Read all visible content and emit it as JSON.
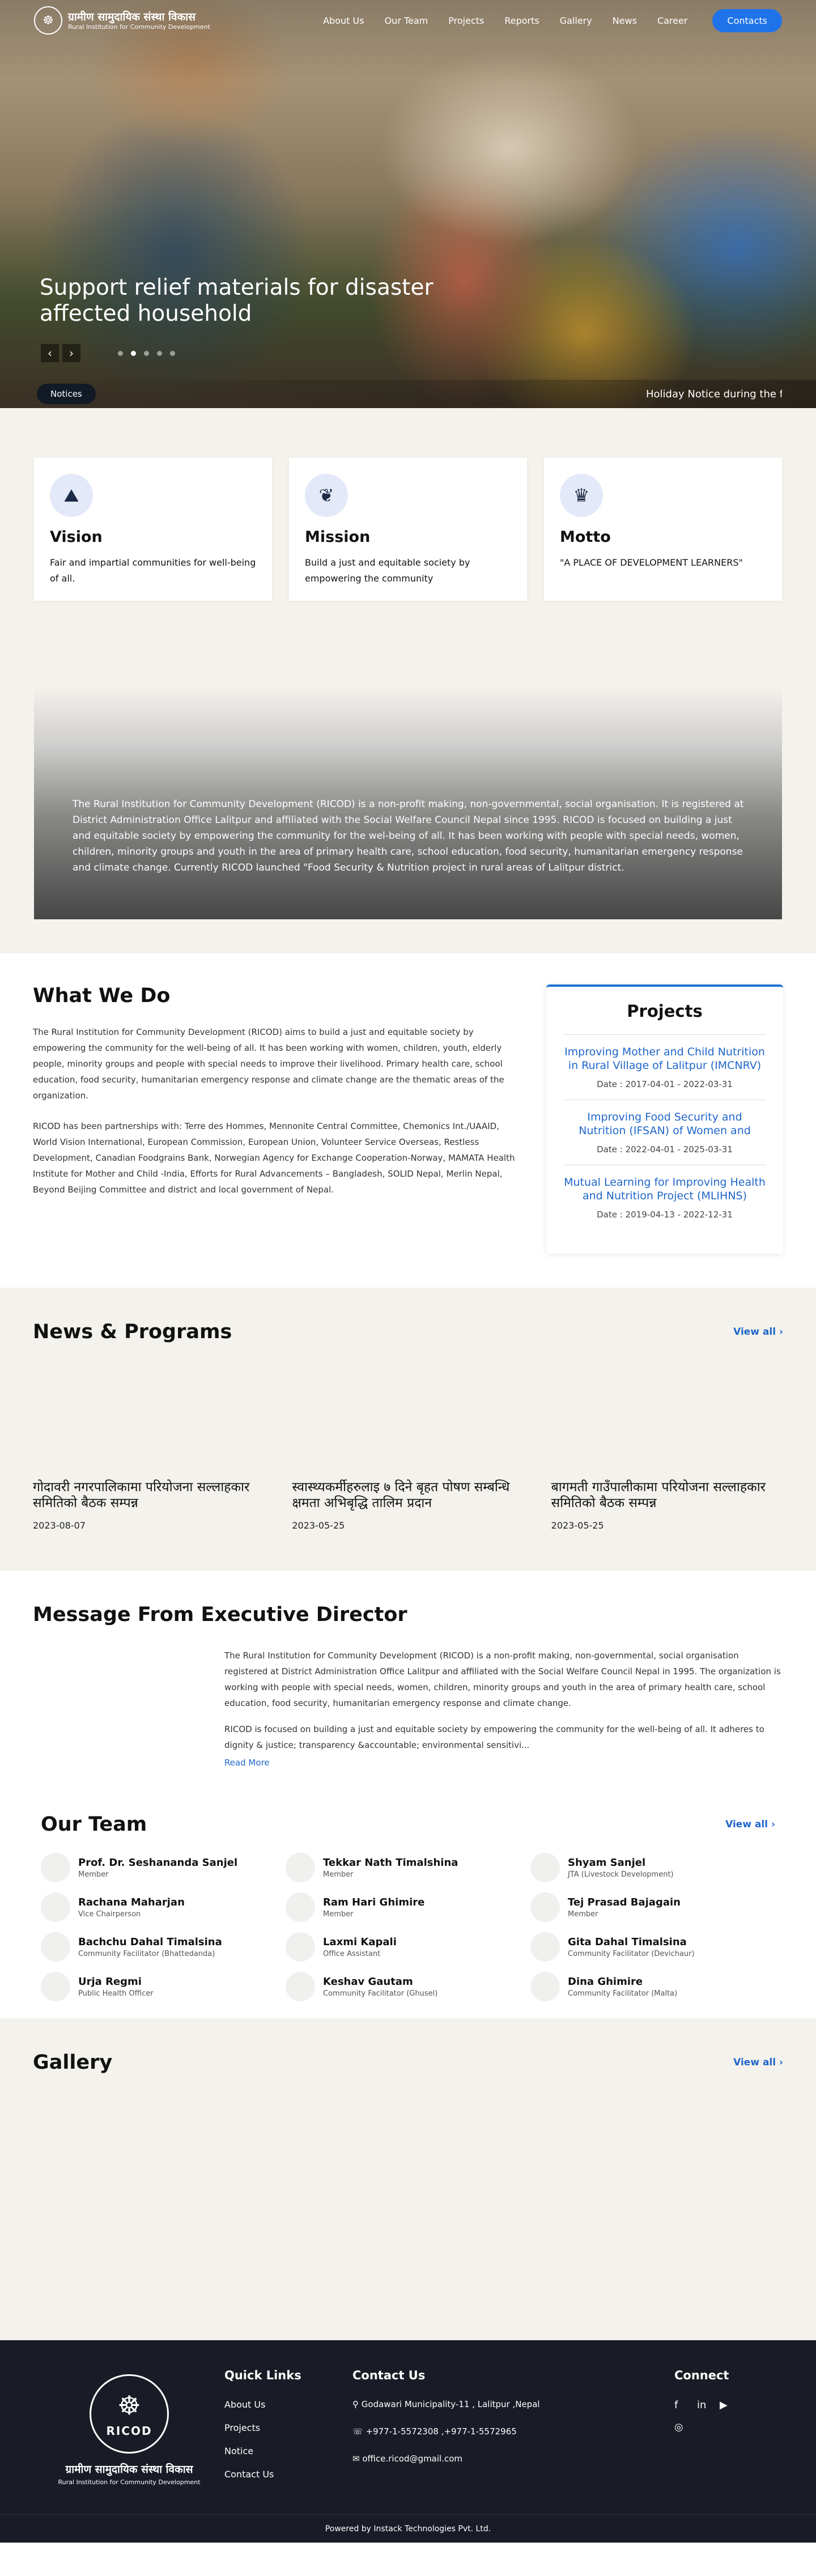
{
  "nav": {
    "brand_name": "ग्रामीण सामुदायिक संस्था विकास",
    "brand_sub": "Rural Institution for Community Development",
    "links": [
      "About Us",
      "Our Team",
      "Projects",
      "Reports",
      "Gallery",
      "News",
      "Career"
    ],
    "contacts": "Contacts"
  },
  "hero": {
    "title": "Support relief materials for disaster affected household",
    "notice_label": "Notices",
    "notice_text": "Holiday Notice during the f"
  },
  "cards": [
    {
      "title": "Vision",
      "text": "Fair and impartial communities for well-being of all."
    },
    {
      "title": "Mission",
      "text": "Build a just and equitable society by empowering the community"
    },
    {
      "title": "Motto",
      "text": "\"A PLACE OF DEVELOPMENT LEARNERS\""
    }
  ],
  "about": "The Rural Institution for Community Development (RICOD) is a non-profit making, non-governmental, social organisation. It is registered at District Administration Office Lalitpur and affiliated with the Social Welfare Council Nepal since 1995. RICOD is focused on building a just and equitable society by empowering the community for the wel-being of all. It has been working with people with special needs, women, children, minority groups and youth in the area of primary health care,  school education, food security, humanitarian emergency response and climate change. Currently RICOD launched \"Food Security & Nutrition project in rural areas of Lalitpur district.",
  "wwd": {
    "heading": "What We Do",
    "p1": "The Rural Institution for Community Development (RICOD) aims to build a just and equitable society by empowering the community for the well-being of all.  It has been working with women, children, youth, elderly people, minority groups and people with special needs to improve their livelihood.  Primary health care,  school education, food security, humanitarian emergency response and climate change are the thematic areas of the organization.",
    "p2": "RICOD has been partnerships with: Terre des Hommes, Mennonite Central Committee, Chemonics Int./UAAID, World Vision International, European Commission, European Union, Volunteer Service Overseas, Restless Development, Canadian Foodgrains Bank, Norwegian Agency for Exchange Cooperation-Norway, MAMATA Health Institute for Mother and Child -India, Efforts for Rural Advancements – Bangladesh, SOLID Nepal, Merlin Nepal, Beyond Beijing Committee and district and local government of Nepal."
  },
  "projects": {
    "heading": "Projects",
    "items": [
      {
        "title": "Improving Mother and Child Nutrition in Rural Village of Lalitpur (IMCNRV)",
        "date": "Date : 2017-04-01 - 2022-03-31"
      },
      {
        "title": "Improving Food Security and Nutrition (IFSAN) of Women and Children in",
        "date": "Date : 2022-04-01 - 2025-03-31"
      },
      {
        "title": "Mutual Learning for Improving Health and Nutrition Project (MLIHNS)",
        "date": "Date : 2019-04-13 - 2022-12-31"
      }
    ]
  },
  "news": {
    "heading": "News & Programs",
    "view_all": "View all ›",
    "items": [
      {
        "title": "गोदावरी नगरपालिकामा परियोजना सल्लाहकार समितिको बैठक सम्पन्न",
        "date": "2023-08-07"
      },
      {
        "title": "स्वास्थ्यकर्मीहरुलाइ ७ दिने बृहत पोषण सम्बन्धि क्षमता अभिबृद्धि तालिम प्रदान",
        "date": "2023-05-25"
      },
      {
        "title": "बागमती गाउँपालीकामा परियोजना सल्लाहकार समितिको बैठक सम्पन्न",
        "date": "2023-05-25"
      }
    ]
  },
  "message": {
    "heading": "Message From Executive Director",
    "p1": "The Rural Institution for Community Development (RICOD) is a non-profit making, non-governmental, social organisation registered at District Administration Office Lalitpur and affiliated with the Social Welfare Council Nepal in 1995. The organization is working with people with special needs, women, children, minority groups and youth in the area of primary health care,  school education, food security, humanitarian emergency response and climate change.",
    "p2": "RICOD is focused on building a just and equitable society by empowering the community for the well-being of all. It adheres to dignity & justice; transparency &accountable; environmental sensitivi...",
    "read_more": "Read More"
  },
  "team": {
    "heading": "Our Team",
    "view_all": "View all ›",
    "members": [
      {
        "name": "Prof. Dr. Seshananda Sanjel",
        "role": "Member"
      },
      {
        "name": "Tekkar Nath Timalshina",
        "role": "Member"
      },
      {
        "name": "Shyam Sanjel",
        "role": "JTA (Livestock Development)"
      },
      {
        "name": "Rachana Maharjan",
        "role": "Vice Chairperson"
      },
      {
        "name": "Ram Hari Ghimire",
        "role": "Member"
      },
      {
        "name": "Tej Prasad Bajagain",
        "role": "Member"
      },
      {
        "name": "Bachchu Dahal Timalsina",
        "role": "Community Facilitator (Bhattedanda)"
      },
      {
        "name": "Laxmi Kapali",
        "role": "Office Assistant"
      },
      {
        "name": "Gita Dahal Timalsina",
        "role": "Community Facilitator (Devichaur)"
      },
      {
        "name": "Urja Regmi",
        "role": "Public Health Officer"
      },
      {
        "name": "Keshav Gautam",
        "role": "Community Facilitator (Ghusel)"
      },
      {
        "name": "Dina Ghimire",
        "role": "Community Facilitator (Malta)"
      }
    ]
  },
  "gallery": {
    "heading": "Gallery",
    "view_all": "View all ›"
  },
  "footer": {
    "logo_word": "RICOD",
    "name": "ग्रामीण सामुदायिक संस्था विकास",
    "sub": "Rural Institution for Community Development",
    "quick_links_heading": "Quick Links",
    "quick_links": [
      "About Us",
      "Projects",
      "Notice",
      "Contact Us"
    ],
    "contact_heading": "Contact Us",
    "address": "Godawari Municipality-11 , Lalitpur ,Nepal",
    "phone": "+977-1-5572308 ,+977-1-5572965",
    "email": "office.ricod@gmail.com",
    "connect_heading": "Connect",
    "powered": "Powered by Instack Technologies Pvt. Ltd."
  },
  "icons": {
    "vision": "mountain-icon",
    "mission": "sprout-icon",
    "motto": "trophy-icon"
  },
  "colors": {
    "accent": "#1f73e8",
    "footer_bg": "#191c26",
    "section_bg": "#f4f2ec"
  }
}
